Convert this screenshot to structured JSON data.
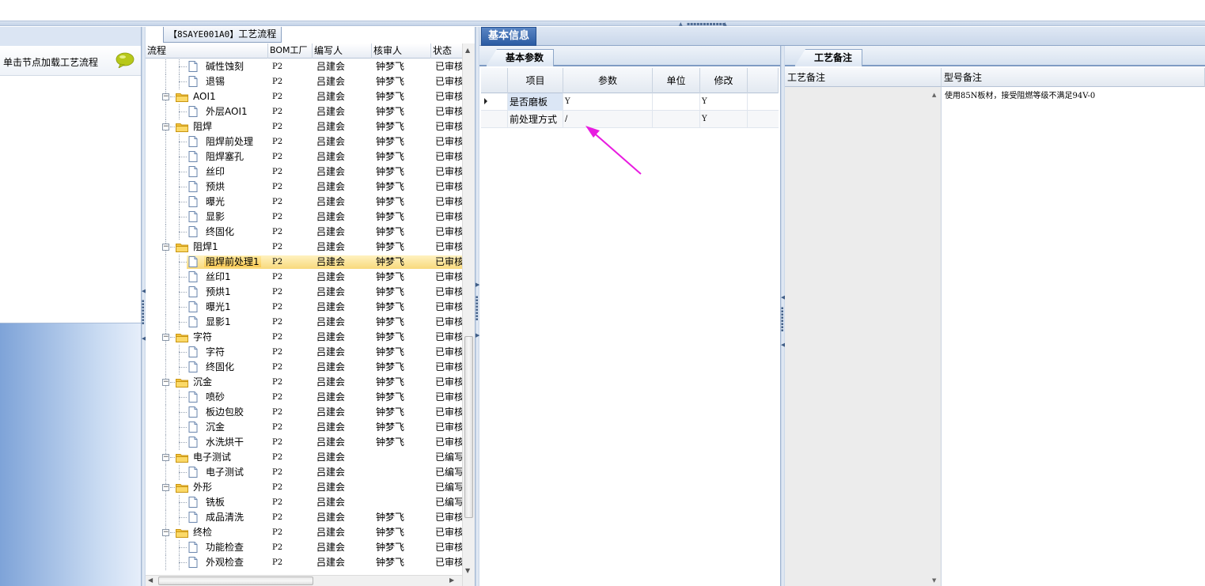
{
  "tree": {
    "title_code": "【8SAYE001A0】",
    "title_text": "工艺流程",
    "columns": [
      "流程",
      "BOM工厂",
      "编写人",
      "核审人",
      "状态"
    ],
    "rows": [
      {
        "depth": 2,
        "type": "doc",
        "name": "碱性蚀刻",
        "bom": "P2",
        "writer": "吕建会",
        "reviewer": "钟梦飞",
        "status": "已审核"
      },
      {
        "depth": 2,
        "type": "doc",
        "name": "退锡",
        "bom": "P2",
        "writer": "吕建会",
        "reviewer": "钟梦飞",
        "status": "已审核"
      },
      {
        "depth": 1,
        "type": "folder",
        "name": "AOI1",
        "bom": "P2",
        "writer": "吕建会",
        "reviewer": "钟梦飞",
        "status": "已审核"
      },
      {
        "depth": 2,
        "type": "doc",
        "name": "外层AOI1",
        "bom": "P2",
        "writer": "吕建会",
        "reviewer": "钟梦飞",
        "status": "已审核"
      },
      {
        "depth": 1,
        "type": "folder",
        "name": "阻焊",
        "bom": "P2",
        "writer": "吕建会",
        "reviewer": "钟梦飞",
        "status": "已审核"
      },
      {
        "depth": 2,
        "type": "doc",
        "name": "阻焊前处理",
        "bom": "P2",
        "writer": "吕建会",
        "reviewer": "钟梦飞",
        "status": "已审核"
      },
      {
        "depth": 2,
        "type": "doc",
        "name": "阻焊塞孔",
        "bom": "P2",
        "writer": "吕建会",
        "reviewer": "钟梦飞",
        "status": "已审核"
      },
      {
        "depth": 2,
        "type": "doc",
        "name": "丝印",
        "bom": "P2",
        "writer": "吕建会",
        "reviewer": "钟梦飞",
        "status": "已审核"
      },
      {
        "depth": 2,
        "type": "doc",
        "name": "预烘",
        "bom": "P2",
        "writer": "吕建会",
        "reviewer": "钟梦飞",
        "status": "已审核"
      },
      {
        "depth": 2,
        "type": "doc",
        "name": "曝光",
        "bom": "P2",
        "writer": "吕建会",
        "reviewer": "钟梦飞",
        "status": "已审核"
      },
      {
        "depth": 2,
        "type": "doc",
        "name": "显影",
        "bom": "P2",
        "writer": "吕建会",
        "reviewer": "钟梦飞",
        "status": "已审核"
      },
      {
        "depth": 2,
        "type": "doc",
        "name": "终固化",
        "bom": "P2",
        "writer": "吕建会",
        "reviewer": "钟梦飞",
        "status": "已审核"
      },
      {
        "depth": 1,
        "type": "folder",
        "name": "阻焊1",
        "bom": "P2",
        "writer": "吕建会",
        "reviewer": "钟梦飞",
        "status": "已审核"
      },
      {
        "depth": 2,
        "type": "doc",
        "name": "阻焊前处理1",
        "bom": "P2",
        "writer": "吕建会",
        "reviewer": "钟梦飞",
        "status": "已审核",
        "selected": true
      },
      {
        "depth": 2,
        "type": "doc",
        "name": "丝印1",
        "bom": "P2",
        "writer": "吕建会",
        "reviewer": "钟梦飞",
        "status": "已审核"
      },
      {
        "depth": 2,
        "type": "doc",
        "name": "预烘1",
        "bom": "P2",
        "writer": "吕建会",
        "reviewer": "钟梦飞",
        "status": "已审核"
      },
      {
        "depth": 2,
        "type": "doc",
        "name": "曝光1",
        "bom": "P2",
        "writer": "吕建会",
        "reviewer": "钟梦飞",
        "status": "已审核"
      },
      {
        "depth": 2,
        "type": "doc",
        "name": "显影1",
        "bom": "P2",
        "writer": "吕建会",
        "reviewer": "钟梦飞",
        "status": "已审核"
      },
      {
        "depth": 1,
        "type": "folder",
        "name": "字符",
        "bom": "P2",
        "writer": "吕建会",
        "reviewer": "钟梦飞",
        "status": "已审核"
      },
      {
        "depth": 2,
        "type": "doc",
        "name": "字符",
        "bom": "P2",
        "writer": "吕建会",
        "reviewer": "钟梦飞",
        "status": "已审核"
      },
      {
        "depth": 2,
        "type": "doc",
        "name": "终固化",
        "bom": "P2",
        "writer": "吕建会",
        "reviewer": "钟梦飞",
        "status": "已审核"
      },
      {
        "depth": 1,
        "type": "folder",
        "name": "沉金",
        "bom": "P2",
        "writer": "吕建会",
        "reviewer": "钟梦飞",
        "status": "已审核"
      },
      {
        "depth": 2,
        "type": "doc",
        "name": "喷砂",
        "bom": "P2",
        "writer": "吕建会",
        "reviewer": "钟梦飞",
        "status": "已审核"
      },
      {
        "depth": 2,
        "type": "doc",
        "name": "板边包胶",
        "bom": "P2",
        "writer": "吕建会",
        "reviewer": "钟梦飞",
        "status": "已审核"
      },
      {
        "depth": 2,
        "type": "doc",
        "name": "沉金",
        "bom": "P2",
        "writer": "吕建会",
        "reviewer": "钟梦飞",
        "status": "已审核"
      },
      {
        "depth": 2,
        "type": "doc",
        "name": "水洗烘干",
        "bom": "P2",
        "writer": "吕建会",
        "reviewer": "钟梦飞",
        "status": "已审核"
      },
      {
        "depth": 1,
        "type": "folder",
        "name": "电子测试",
        "bom": "P2",
        "writer": "吕建会",
        "reviewer": "",
        "status": "已编写"
      },
      {
        "depth": 2,
        "type": "doc",
        "name": "电子测试",
        "bom": "P2",
        "writer": "吕建会",
        "reviewer": "",
        "status": "已编写"
      },
      {
        "depth": 1,
        "type": "folder",
        "name": "外形",
        "bom": "P2",
        "writer": "吕建会",
        "reviewer": "",
        "status": "已编写"
      },
      {
        "depth": 2,
        "type": "doc",
        "name": "铣板",
        "bom": "P2",
        "writer": "吕建会",
        "reviewer": "",
        "status": "已编写"
      },
      {
        "depth": 2,
        "type": "doc",
        "name": "成品清洗",
        "bom": "P2",
        "writer": "吕建会",
        "reviewer": "钟梦飞",
        "status": "已审核"
      },
      {
        "depth": 1,
        "type": "folder",
        "name": "终检",
        "bom": "P2",
        "writer": "吕建会",
        "reviewer": "钟梦飞",
        "status": "已审核"
      },
      {
        "depth": 2,
        "type": "doc",
        "name": "功能检查",
        "bom": "P2",
        "writer": "吕建会",
        "reviewer": "钟梦飞",
        "status": "已审核"
      },
      {
        "depth": 2,
        "type": "doc",
        "name": "外观检查",
        "bom": "P2",
        "writer": "吕建会",
        "reviewer": "钟梦飞",
        "status": "已审核"
      }
    ]
  },
  "left_panel": {
    "hint": "单击节点加载工艺流程"
  },
  "basic_info": {
    "main_tab": "基本信息",
    "sub_tab": "基本参数",
    "columns": [
      "项目",
      "参数",
      "单位",
      "修改"
    ],
    "rows": [
      {
        "item": "是否磨板",
        "param": "Y",
        "unit": "",
        "modify": "Y",
        "current": true
      },
      {
        "item": "前处理方式",
        "param": "/",
        "unit": "",
        "modify": "Y",
        "current": false
      }
    ]
  },
  "notes": {
    "tab": "工艺备注",
    "columns": [
      "工艺备注",
      "型号备注"
    ],
    "model_note": "使用85N板材，接受阻燃等级不满足94V-0"
  },
  "colors": {
    "accent": "#2b5ba3",
    "selection": "#f9c955",
    "annotation_arrow": "#e81ce0"
  }
}
